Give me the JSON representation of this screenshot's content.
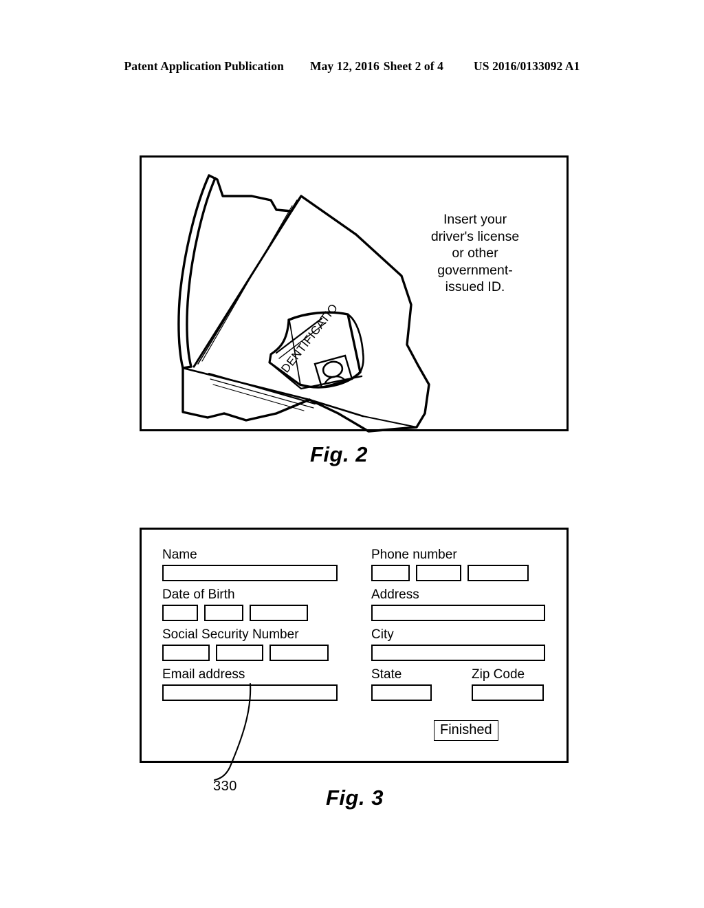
{
  "header": {
    "publication": "Patent Application Publication",
    "date": "May 12, 2016",
    "sheet": "Sheet 2 of 4",
    "patent_number": "US 2016/0133092 A1"
  },
  "figures": [
    {
      "id": "fig2",
      "caption": "Fig. 2",
      "instruction_text": "Insert your driver's license or other government-issued ID.",
      "instruction_lines": [
        "Insert your",
        "driver's license",
        "or other",
        "government-",
        "issued ID."
      ],
      "card_label": "IDENTIFICATIO",
      "description": "Kiosk with angled display panel and card slot receiving an identification card"
    },
    {
      "id": "fig3",
      "caption": "Fig. 3",
      "reference_numeral": "330",
      "description": "Data entry form screen"
    }
  ],
  "form": {
    "left_column": [
      {
        "label": "Name",
        "name": "name",
        "boxes": [
          {
            "size": "box-full"
          }
        ]
      },
      {
        "label": "Date of Birth",
        "name": "date-of-birth",
        "boxes": [
          {
            "size": "box-xs"
          },
          {
            "size": "box-sm"
          },
          {
            "size": "box-lg"
          }
        ]
      },
      {
        "label": "Social Security Number",
        "name": "social-security-number",
        "boxes": [
          {
            "size": "box-ssn1"
          },
          {
            "size": "box-ssn2"
          },
          {
            "size": "box-ssn3"
          }
        ]
      },
      {
        "label": "Email address",
        "name": "email-address",
        "boxes": [
          {
            "size": "box-full"
          }
        ]
      }
    ],
    "right_column": [
      {
        "label": "Phone number",
        "name": "phone-number",
        "boxes": [
          {
            "size": "box-ph1"
          },
          {
            "size": "box-ph2"
          },
          {
            "size": "box-ph3"
          }
        ]
      },
      {
        "label": "Address",
        "name": "address",
        "boxes": [
          {
            "size": "box-wide"
          }
        ]
      },
      {
        "label": "City",
        "name": "city",
        "boxes": [
          {
            "size": "box-wide"
          }
        ]
      }
    ],
    "split_row": [
      {
        "label": "State",
        "name": "state",
        "boxes": [
          {
            "size": "box-state"
          }
        ]
      },
      {
        "label": "Zip Code",
        "name": "zip-code",
        "boxes": [
          {
            "size": "box-zip"
          }
        ]
      }
    ],
    "submit_button": "Finished"
  },
  "colors": {
    "ink": "#000000",
    "paper": "#ffffff"
  }
}
